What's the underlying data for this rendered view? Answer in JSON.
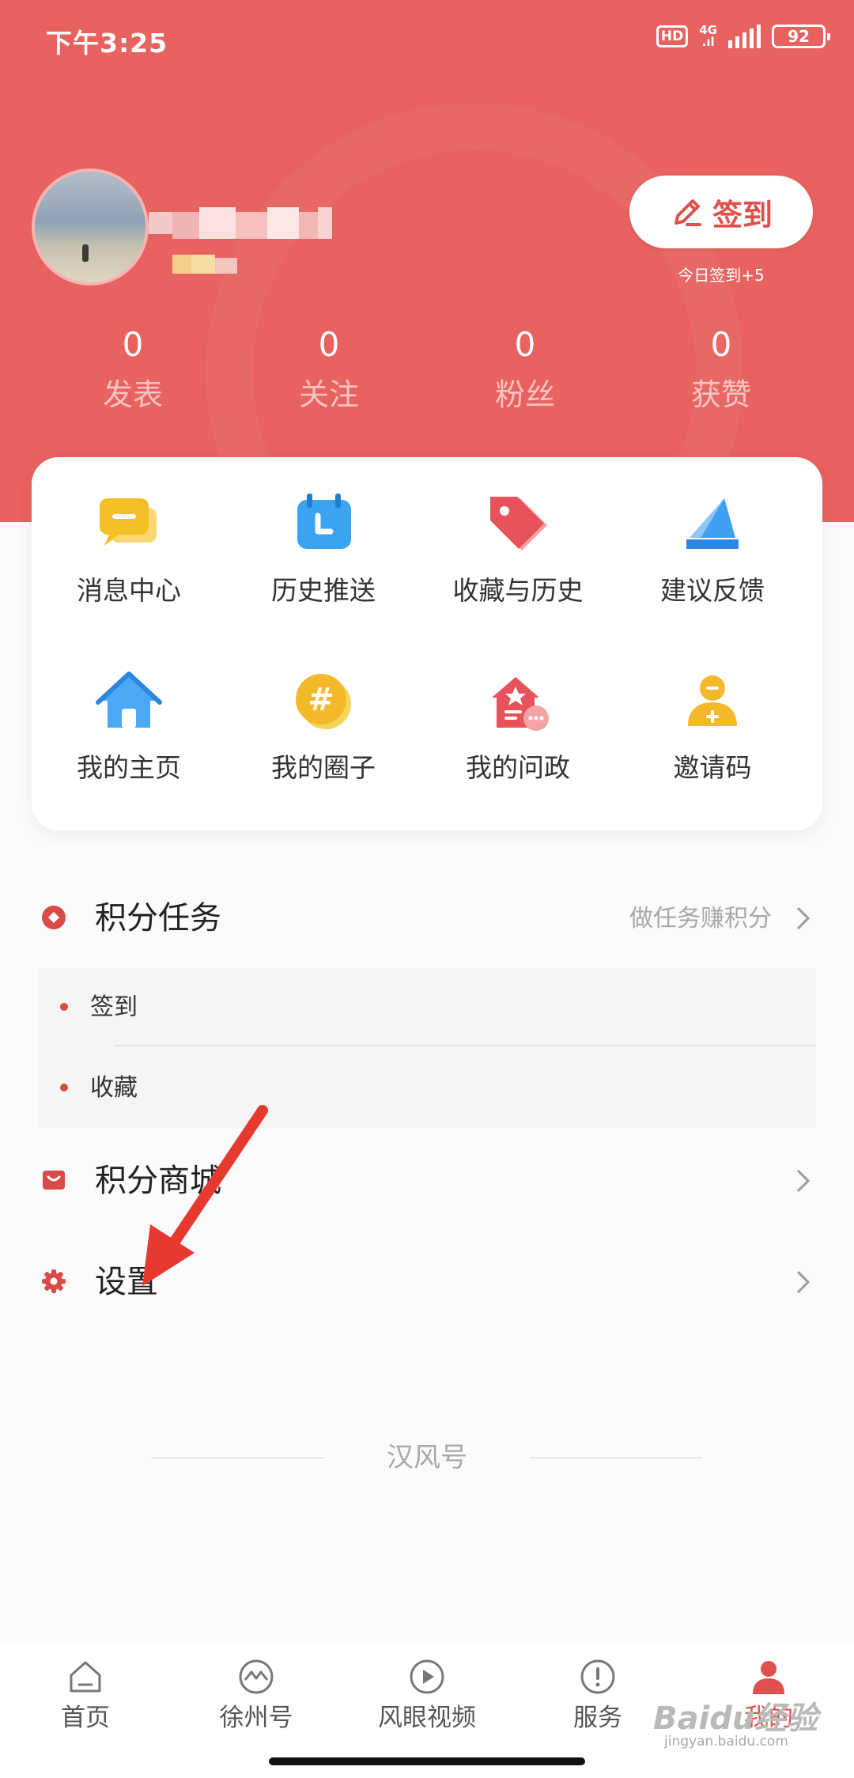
{
  "status_bar": {
    "time": "下午3:25",
    "hd": "HD",
    "network": "4G",
    "battery": "92"
  },
  "profile": {
    "checkin_button": "签到",
    "checkin_note": "今日签到+5"
  },
  "stats": [
    {
      "value": "0",
      "label": "发表"
    },
    {
      "value": "0",
      "label": "关注"
    },
    {
      "value": "0",
      "label": "粉丝"
    },
    {
      "value": "0",
      "label": "获赞"
    }
  ],
  "grid": [
    {
      "label": "消息中心",
      "icon": "message-icon"
    },
    {
      "label": "历史推送",
      "icon": "calendar-icon"
    },
    {
      "label": "收藏与历史",
      "icon": "tag-icon"
    },
    {
      "label": "建议反馈",
      "icon": "feedback-icon"
    },
    {
      "label": "我的主页",
      "icon": "home-icon"
    },
    {
      "label": "我的圈子",
      "icon": "hashtag-icon"
    },
    {
      "label": "我的问政",
      "icon": "government-icon"
    },
    {
      "label": "邀请码",
      "icon": "invite-icon"
    }
  ],
  "menu": {
    "points_task": {
      "title": "积分任务",
      "hint": "做任务赚积分"
    },
    "tasks": [
      "签到",
      "收藏"
    ],
    "points_mall": {
      "title": "积分商城"
    },
    "settings": {
      "title": "设置"
    }
  },
  "footer_brand": "汉风号",
  "tabs": [
    {
      "label": "首页",
      "icon": "home-tab-icon"
    },
    {
      "label": "徐州号",
      "icon": "pulse-icon"
    },
    {
      "label": "风眼视频",
      "icon": "play-icon"
    },
    {
      "label": "服务",
      "icon": "alert-icon"
    },
    {
      "label": "我的",
      "icon": "person-icon"
    }
  ],
  "watermark": {
    "brand": "Baidu经验",
    "site": "jingyan.baidu.com"
  },
  "colors": {
    "brand_red": "#e8625f",
    "accent": "#e0514e"
  }
}
